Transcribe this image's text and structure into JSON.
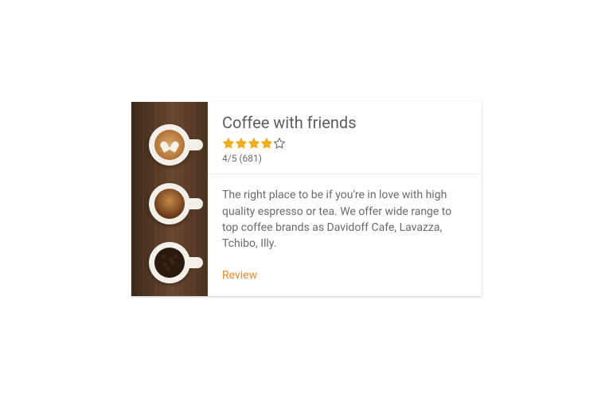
{
  "card": {
    "title": "Coffee with friends",
    "rating_text": "4/5 (681)",
    "rating_value": 4,
    "rating_max": 5,
    "description": "The right place to be if you're in love with high quality espresso or tea. We offer wide range to top coffee brands as Davidoff Cafe, Lavazza, Tchibo, Illy.",
    "action_label": "Review",
    "image_alt": "three-coffee-cups-on-wood",
    "colors": {
      "accent": "#e58a2b",
      "star_fill": "#f0ab1e",
      "star_empty": "#555555"
    }
  }
}
